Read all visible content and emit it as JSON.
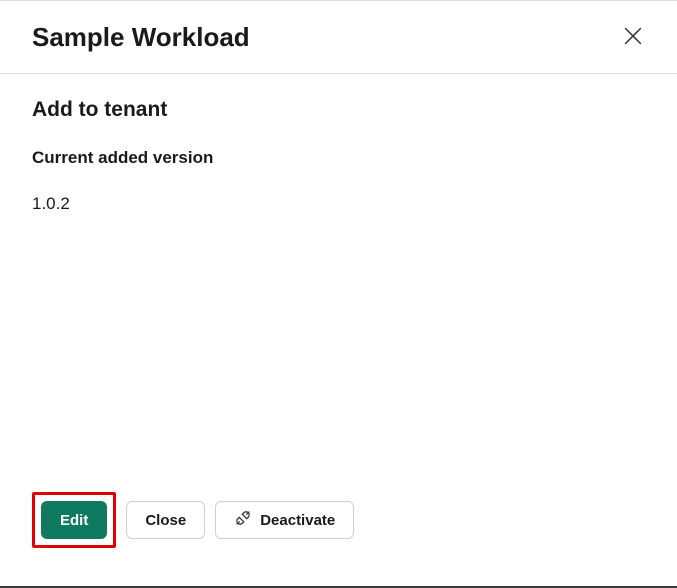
{
  "header": {
    "title": "Sample Workload"
  },
  "main": {
    "section_title": "Add to tenant",
    "version_label": "Current added version",
    "version_value": "1.0.2"
  },
  "footer": {
    "edit_label": "Edit",
    "close_label": "Close",
    "deactivate_label": "Deactivate"
  },
  "colors": {
    "accent": "#0f7a5f",
    "highlight": "#e30000"
  }
}
